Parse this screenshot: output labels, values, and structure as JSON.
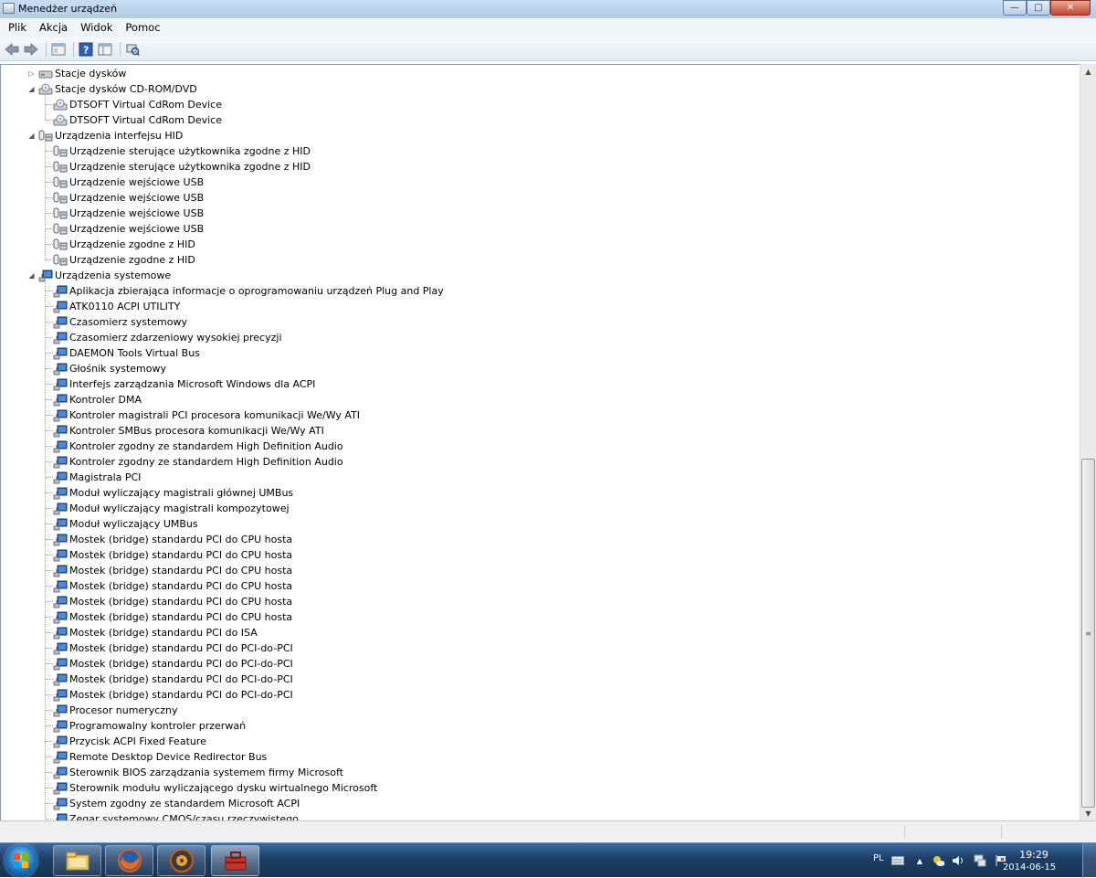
{
  "window": {
    "title": "Menedżer urządzeń",
    "buttons": {
      "minimize": "—",
      "maximize": "□",
      "close": "✕"
    }
  },
  "menu": [
    "Plik",
    "Akcja",
    "Widok",
    "Pomoc"
  ],
  "toolbar_icons": [
    "back-arrow-icon",
    "forward-arrow-icon",
    "properties-icon",
    "help-icon",
    "show-hide-console-tree-icon",
    "scan-hardware-icon"
  ],
  "tree": {
    "categories": [
      {
        "label": "Stacje dysków",
        "expanded": false,
        "icon": "disk-drive-icon",
        "children": []
      },
      {
        "label": "Stacje dysków CD-ROM/DVD",
        "expanded": true,
        "icon": "cdrom-drive-icon",
        "children": [
          "DTSOFT Virtual CdRom Device",
          "DTSOFT Virtual CdRom Device"
        ]
      },
      {
        "label": "Urządzenia interfejsu HID",
        "expanded": true,
        "icon": "hid-device-icon",
        "children": [
          "Urządzenie sterujące użytkownika zgodne z HID",
          "Urządzenie sterujące użytkownika zgodne z HID",
          "Urządzenie wejściowe USB",
          "Urządzenie wejściowe USB",
          "Urządzenie wejściowe USB",
          "Urządzenie wejściowe USB",
          "Urządzenie zgodne z HID",
          "Urządzenie zgodne z HID"
        ]
      },
      {
        "label": "Urządzenia systemowe",
        "expanded": true,
        "icon": "system-device-icon",
        "children": [
          "Aplikacja zbierająca informacje o oprogramowaniu urządzeń Plug and Play",
          "ATK0110 ACPI UTILITY",
          "Czasomierz systemowy",
          "Czasomierz zdarzeniowy wysokiej precyzji",
          "DAEMON Tools Virtual Bus",
          "Głośnik systemowy",
          "Interfejs zarządzania Microsoft Windows dla ACPI",
          "Kontroler DMA",
          "Kontroler magistrali PCI procesora komunikacji We/Wy ATI",
          "Kontroler SMBus procesora komunikacji We/Wy ATI",
          "Kontroler zgodny ze standardem High Definition Audio",
          "Kontroler zgodny ze standardem High Definition Audio",
          "Magistrala PCI",
          "Moduł wyliczający magistrali głównej UMBus",
          "Moduł wyliczający magistrali kompozytowej",
          "Moduł wyliczający UMBus",
          "Mostek (bridge) standardu PCI do CPU hosta",
          "Mostek (bridge) standardu PCI do CPU hosta",
          "Mostek (bridge) standardu PCI do CPU hosta",
          "Mostek (bridge) standardu PCI do CPU hosta",
          "Mostek (bridge) standardu PCI do CPU hosta",
          "Mostek (bridge) standardu PCI do CPU hosta",
          "Mostek (bridge) standardu PCI do ISA",
          "Mostek (bridge) standardu PCI do PCI-do-PCI",
          "Mostek (bridge) standardu PCI do PCI-do-PCI",
          "Mostek (bridge) standardu PCI do PCI-do-PCI",
          "Mostek (bridge) standardu PCI do PCI-do-PCI",
          "Procesor numeryczny",
          "Programowalny kontroler przerwań",
          "Przycisk ACPI Fixed Feature",
          "Remote Desktop Device Redirector Bus",
          "Sterownik BIOS zarządzania systemem firmy Microsoft",
          "Sterownik modułu wyliczającego dysku wirtualnego Microsoft",
          "System zgodny ze standardem Microsoft ACPI",
          "Zegar systemowy CMOS/czasu rzeczywistego"
        ]
      }
    ]
  },
  "taskbar": {
    "apps": [
      "windows-explorer-icon",
      "firefox-icon",
      "media-app-icon",
      "toolbox-app-icon"
    ],
    "tray": {
      "language": "PL",
      "time": "19:29",
      "date": "2014-06-15"
    }
  },
  "colors": {
    "titlebar": "#c9dcf1",
    "taskbar": "#1e3e66",
    "tree_bg": "#ffffff"
  }
}
